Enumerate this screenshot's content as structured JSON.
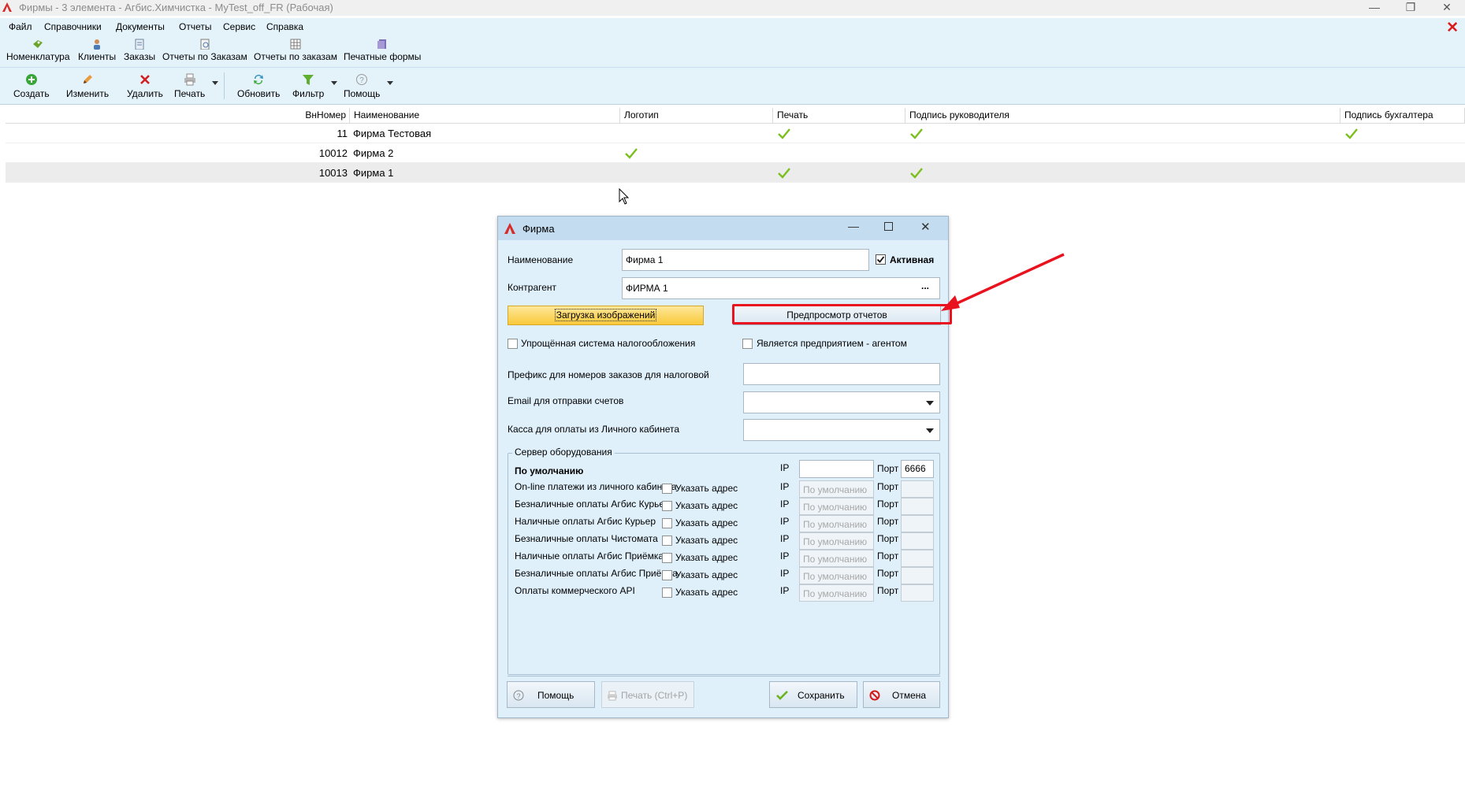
{
  "window": {
    "title": "Фирмы - 3 элемента - Агбис.Химчистка - MyTest_off_FR (Рабочая)",
    "minimize": "—",
    "restore": "❐",
    "close": "✕",
    "app_close": "✕"
  },
  "menu": [
    "Файл",
    "Справочники",
    "Документы",
    "Отчеты",
    "Сервис",
    "Справка"
  ],
  "nav_toolbar": [
    {
      "label": "Номенклатура",
      "icon": "nomenclature-icon"
    },
    {
      "label": "Клиенты",
      "icon": "clients-icon"
    },
    {
      "label": "Заказы",
      "icon": "orders-icon"
    },
    {
      "label": "Отчеты по Заказам",
      "icon": "order-reports-icon"
    },
    {
      "label": "Отчеты по заказам",
      "icon": "order-reports-table-icon"
    },
    {
      "label": "Печатные формы",
      "icon": "print-forms-icon"
    }
  ],
  "action_toolbar": [
    {
      "label": "Создать",
      "icon": "plus-icon"
    },
    {
      "label": "Изменить",
      "icon": "pencil-icon"
    },
    {
      "label": "Удалить",
      "icon": "delete-x-icon"
    },
    {
      "label": "Печать",
      "icon": "printer-icon"
    },
    {
      "label": "Обновить",
      "icon": "refresh-icon"
    },
    {
      "label": "Фильтр",
      "icon": "filter-icon"
    },
    {
      "label": "Помощь",
      "icon": "help-icon"
    }
  ],
  "grid": {
    "columns": [
      "ВнНомер",
      "Наименование",
      "Логотип",
      "Печать",
      "Подпись руководителя",
      "Подпись бухгалтера"
    ],
    "rows": [
      {
        "id": "11",
        "name": "Фирма Тестовая",
        "logo": false,
        "stamp": true,
        "director_sign": true,
        "accountant_sign": true
      },
      {
        "id": "10012",
        "name": "Фирма 2",
        "logo": true,
        "stamp": false,
        "director_sign": false,
        "accountant_sign": false
      },
      {
        "id": "10013",
        "name": "Фирма 1",
        "logo": false,
        "stamp": true,
        "director_sign": true,
        "accountant_sign": false
      }
    ],
    "selected_row": 2
  },
  "dialog": {
    "title": "Фирма",
    "name_label": "Наименование",
    "name_value": "Фирма 1",
    "active_label": "Активная",
    "active_checked": true,
    "counterparty_label": "Контрагент",
    "counterparty_value": "ФИРМА 1",
    "ellipsis": "...",
    "load_images_button": "Загрузка изображений",
    "preview_reports_button": "Предпросмотр отчетов",
    "simplified_tax_label": "Упрощённая система налогообложения",
    "agent_label": "Является предприятием - агентом",
    "prefix_label": "Префикс для номеров заказов для налоговой",
    "prefix_value": "",
    "email_label": "Email для отправки счетов",
    "email_value": "",
    "cashbox_label": "Касса для оплаты из Личного кабинета",
    "cashbox_value": "",
    "server_group_label": "Сервер оборудования",
    "default_row": {
      "label": "По умолчанию",
      "ip_label": "IP",
      "ip_value": "",
      "port_label": "Порт",
      "port_value": "6666"
    },
    "specify_address_label": "Указать адрес",
    "ip_label": "IP",
    "port_label": "Порт",
    "ip_placeholder": "По умолчанию",
    "server_rows": [
      "On-line платежи из личного кабинета",
      "Безналичные оплаты Агбис Курьер",
      "Наличные оплаты Агбис Курьер",
      "Безналичные оплаты Чистомата",
      "Наличные оплаты Агбис Приёмка",
      "Безналичные оплаты Агбис Приёмка",
      "Оплаты коммерческого API"
    ],
    "help_button": "Помощь",
    "print_button": "Печать (Ctrl+P)",
    "save_button": "Сохранить",
    "cancel_button": "Отмена"
  },
  "colors": {
    "toolbar_bg": "#e4f2fa",
    "dialog_bg": "#dff0fb",
    "highlight_red": "#e8131f",
    "check_green": "#7bbf1e",
    "accent_yellow": "#fcd34d"
  }
}
